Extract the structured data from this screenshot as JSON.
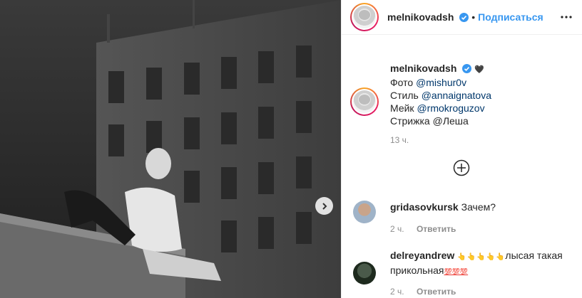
{
  "post": {
    "username": "melnikovadsh",
    "separator": "•",
    "follow_label": "Подписаться",
    "caption_emoji": "🖤",
    "caption_lines": [
      {
        "label": "Фото",
        "mention": "@mishur0v"
      },
      {
        "label": "Стиль",
        "mention": "@annaignatova"
      },
      {
        "label": "Мейк",
        "mention": "@rmokroguzov"
      },
      {
        "label": "Стрижка @Леша",
        "mention": ""
      }
    ],
    "time": "13 ч."
  },
  "comments": [
    {
      "username": "gridasovkursk",
      "text": "Зачем?",
      "time": "2 ч.",
      "reply": "Ответить"
    },
    {
      "username": "delreyandrew",
      "emojis": "👆👆👆👆👆",
      "text": "лысая такая прикольная",
      "hundreds": "💯💯💯",
      "time": "2 ч.",
      "reply": "Ответить"
    }
  ],
  "colors": {
    "link": "#00376b",
    "follow": "#3897f0",
    "muted": "#8e8e8e",
    "verified": "#3897f0"
  },
  "icons": [
    "verified-badge-icon",
    "more-options-icon",
    "load-more-comments-icon",
    "carousel-next-icon",
    "like-heart-icon"
  ]
}
